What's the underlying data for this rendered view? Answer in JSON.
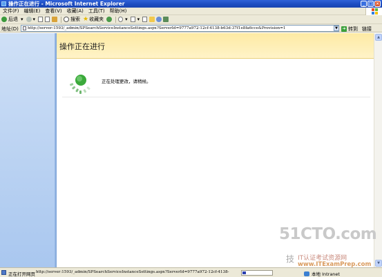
{
  "window": {
    "title": "操作正在进行 - Microsoft Internet Explorer",
    "min_label": "_",
    "max_label": "□",
    "close_label": "×"
  },
  "menu": {
    "items": [
      "文件(F)",
      "编辑(E)",
      "查看(V)",
      "收藏(A)",
      "工具(T)",
      "帮助(H)"
    ]
  },
  "toolbar": {
    "back_label": "后退",
    "search_label": "搜索",
    "favorites_label": "收藏夹"
  },
  "address": {
    "label": "地址(D)",
    "url": "http://server:1593/_admin/SPSearchServiceInstanceSettings.aspx?ServerId=9777a972-12cf-4138-b63d-37f1e8fa6cce&Provision=1",
    "go_label": "转到",
    "links_label": "链接"
  },
  "page": {
    "title": "操作正在进行",
    "message": "正在处理更改，请稍候。"
  },
  "status": {
    "text": "正在打开网页",
    "url": "http://server:1593/_admin/SPSearchServiceInstanceSettings.aspx?ServerId=9777a972-12cf-4138-",
    "zone": "本地 Intranet",
    "progress": 0.12
  },
  "watermark": {
    "logo": "51CTO.com",
    "prefix": "技",
    "line": "IT认证考试资源网",
    "site": "www.ITExamPrep.com"
  },
  "colors": {
    "title_band": "#fdeaa3",
    "left_panel": "#a9c7ef",
    "spinner": "#3aaa3a"
  }
}
